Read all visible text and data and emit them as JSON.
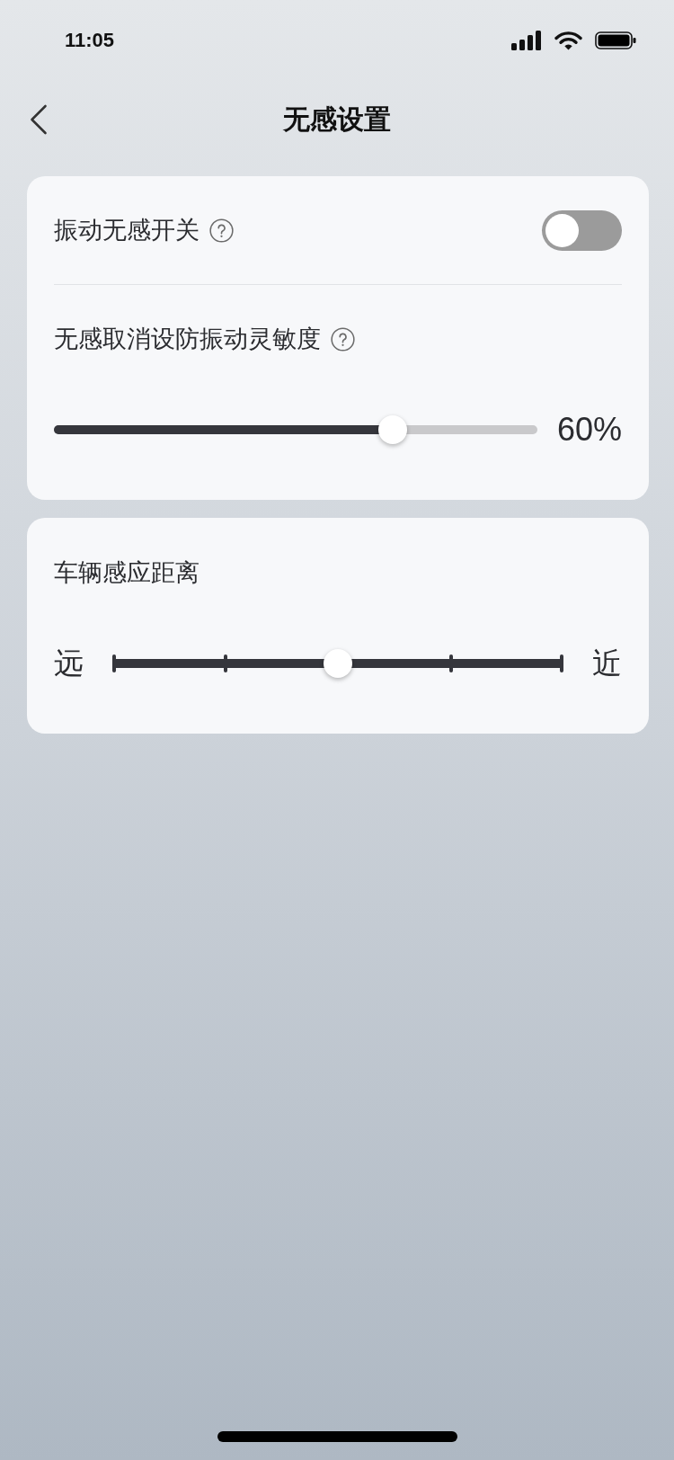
{
  "status_bar": {
    "time": "11:05"
  },
  "header": {
    "title": "无感设置"
  },
  "cards": [
    {
      "rows": [
        {
          "kind": "toggle",
          "label": "振动无感开关",
          "help": true,
          "on": false
        },
        {
          "kind": "slider",
          "label": "无感取消设防振动灵敏度",
          "help": true,
          "level": 0.7,
          "reading": "60%"
        }
      ]
    },
    {
      "rows": [
        {
          "kind": "scale",
          "label": "车辆感应距离",
          "help": false,
          "level": 0.5,
          "min_label": "远",
          "max_label": "近"
        }
      ]
    }
  ]
}
